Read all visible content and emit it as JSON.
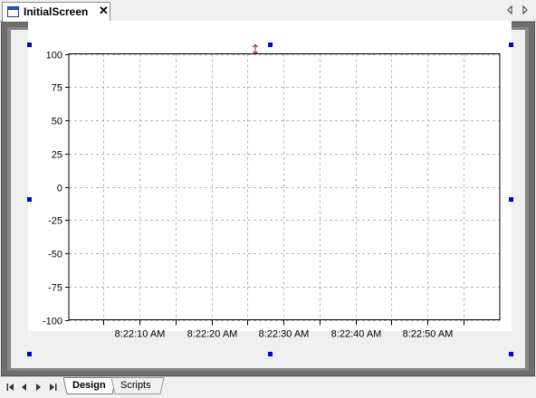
{
  "document_tab": {
    "title": "InitialScreen",
    "close_glyph": "✕",
    "icon": "screen-icon"
  },
  "tab_nav": {
    "left_icon": "triangle-left-icon",
    "right_icon": "triangle-right-icon"
  },
  "chart_data": {
    "type": "line",
    "title": "",
    "xlabel": "",
    "ylabel": "",
    "ylim": [
      -100,
      100
    ],
    "y_ticks": [
      "100",
      "75",
      "50",
      "25",
      "0",
      "-25",
      "-50",
      "-75",
      "-100"
    ],
    "x_tick_labels": [
      "8:22:10 AM",
      "8:22:20 AM",
      "8:22:30 AM",
      "8:22:40 AM",
      "8:22:50 AM"
    ],
    "grid": true,
    "grid_style": "dashed",
    "series": []
  },
  "selection": {
    "handle_color": "#0000dd",
    "resize_icon": "resize-vertical-icon"
  },
  "bottom_tabs": {
    "nav_icons": [
      "first-page-icon",
      "previous-page-icon",
      "next-page-icon",
      "last-page-icon"
    ],
    "tabs": [
      {
        "label": "Design",
        "active": true
      },
      {
        "label": "Scripts",
        "active": false
      }
    ]
  }
}
